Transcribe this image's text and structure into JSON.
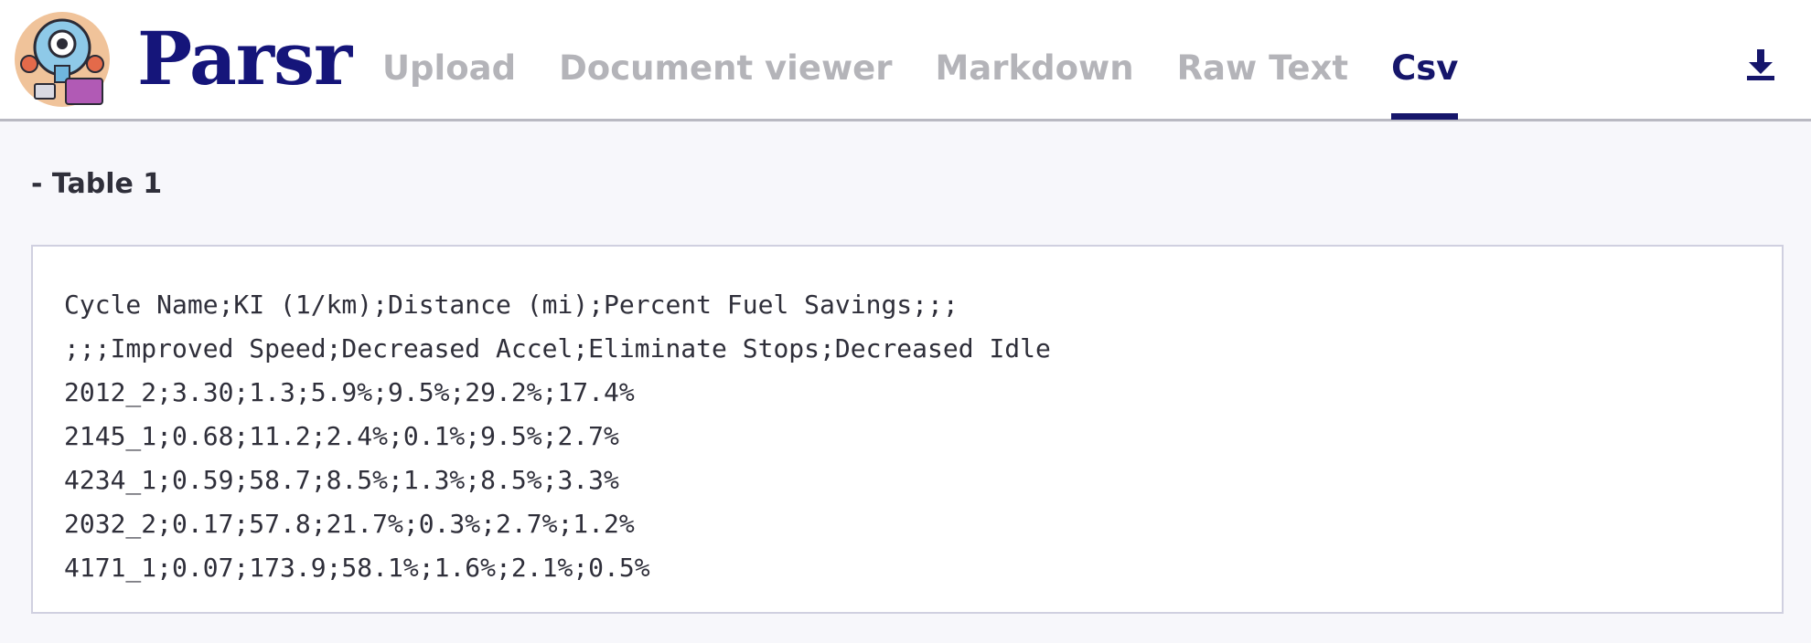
{
  "header": {
    "brand": "Parsr",
    "tabs": [
      {
        "label": "Upload",
        "active": false
      },
      {
        "label": "Document viewer",
        "active": false
      },
      {
        "label": "Markdown",
        "active": false
      },
      {
        "label": "Raw Text",
        "active": false
      },
      {
        "label": "Csv",
        "active": true
      }
    ],
    "download_icon": "download-icon",
    "accent_color": "#16166b"
  },
  "main": {
    "section_title": "- Table 1",
    "csv_lines": [
      "Cycle Name;KI (1/km);Distance (mi);Percent Fuel Savings;;;",
      ";;;Improved Speed;Decreased Accel;Eliminate Stops;Decreased Idle",
      "2012_2;3.30;1.3;5.9%;9.5%;29.2%;17.4%",
      "2145_1;0.68;11.2;2.4%;0.1%;9.5%;2.7%",
      "4234_1;0.59;58.7;8.5%;1.3%;8.5%;3.3%",
      "2032_2;0.17;57.8;21.7%;0.3%;2.7%;1.2%",
      "4171_1;0.07;173.9;58.1%;1.6%;2.1%;0.5%"
    ]
  }
}
